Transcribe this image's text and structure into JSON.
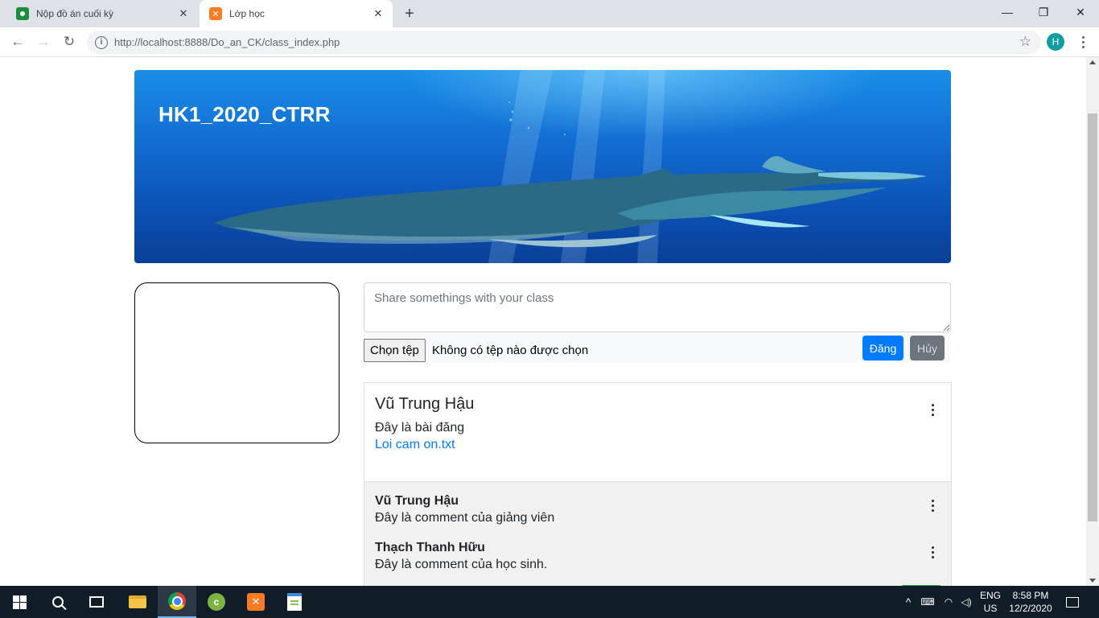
{
  "browser": {
    "tabs": [
      {
        "title": "Nộp đồ án cuối kỳ",
        "icon": "google-classroom-icon",
        "active": false
      },
      {
        "title": "Lớp học",
        "icon": "xampp-icon",
        "active": true
      }
    ],
    "tab_close_glyph": "✕",
    "new_tab_glyph": "+",
    "window_controls": {
      "minimize": "—",
      "maximize": "❐",
      "close": "✕"
    },
    "nav": {
      "back": "←",
      "forward": "→",
      "reload": "↻"
    },
    "url": "http://localhost:8888/Do_an_CK/class_index.php",
    "bookmark_glyph": "☆",
    "profile_initial": "H"
  },
  "banner": {
    "title": "HK1_2020_CTRR",
    "image": "humpback-whales-underwater"
  },
  "composer": {
    "placeholder": "Share somethings with your class",
    "file_button": "Chọn tệp",
    "file_status": "Không có tệp nào được chọn",
    "post_button": "Đăng",
    "cancel_button": "Hủy"
  },
  "post": {
    "author": "Vũ Trung Hậu",
    "content": "Đây là bài đăng",
    "attachment": "Loi cam on.txt",
    "comments": [
      {
        "author": "Vũ Trung Hậu",
        "text": "Đây là comment của giảng viên"
      },
      {
        "author": "Thạch Thanh Hữu",
        "text": "Đây là comment của học sinh."
      }
    ]
  },
  "taskbar": {
    "apps": [
      "start",
      "search",
      "task-view",
      "file-explorer",
      "chrome",
      "coc-coc",
      "xampp",
      "notepad-plus-plus"
    ],
    "tray": {
      "expand": "^",
      "language": "ENG",
      "region": "US",
      "time": "8:58 PM",
      "date": "12/2/2020"
    }
  },
  "colors": {
    "primary": "#007bff",
    "secondary": "#6c757d",
    "taskbar": "#101c26",
    "tab_strip": "#dee1e6"
  }
}
